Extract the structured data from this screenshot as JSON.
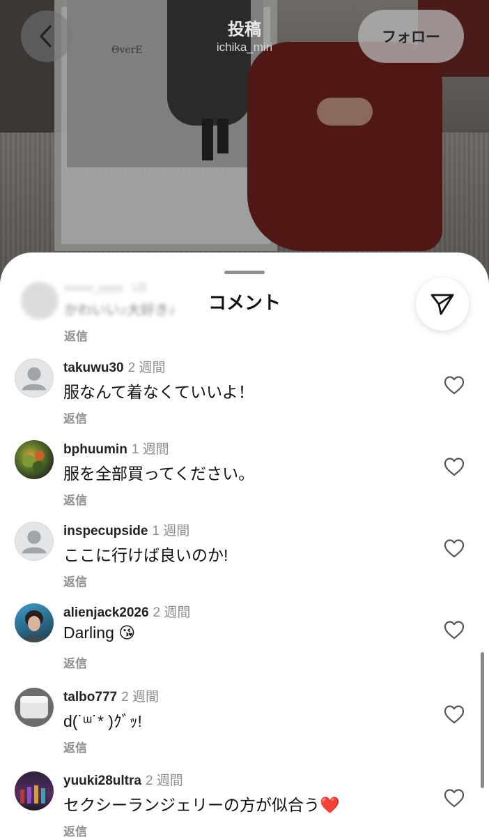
{
  "header": {
    "title": "投稿",
    "subtitle": "ichika_miri",
    "follow_label": "フォロー",
    "panel_text": "ΘverE"
  },
  "sheet": {
    "title": "コメント",
    "blurred_comment": {
      "user": "xxxxxx_yyyyy · 1日",
      "text": "かわいい♪大好き♪",
      "reply": "返信"
    }
  },
  "comments": [
    {
      "user": "takuwu30",
      "time": "2 週間",
      "text": "服なんて着なくていいよ！",
      "reply": "返信",
      "avatar": "default"
    },
    {
      "user": "bphuumin",
      "time": "1 週間",
      "text": "服を全部買ってください。",
      "reply": "返信",
      "avatar": "plants"
    },
    {
      "user": "inspecupside",
      "time": "1 週間",
      "text": "ここに行けば良いのか!",
      "reply": "返信",
      "avatar": "default"
    },
    {
      "user": "alienjack2026",
      "time": "2 週間",
      "text": "Darling 😘",
      "reply": "返信",
      "avatar": "person"
    },
    {
      "user": "talbo777",
      "time": "2 週間",
      "text": "d(˙ᵚ˙* )ｸﾞｯ!",
      "reply": "返信",
      "avatar": "cube"
    },
    {
      "user": "yuuki28ultra",
      "time": "2 週間",
      "text": "セクシーランジェリーの方が似合う❤️",
      "reply": "返信",
      "avatar": "group"
    }
  ],
  "icons": {
    "back": "chevron-left-icon",
    "share": "paper-plane-icon",
    "like": "heart-outline-icon"
  },
  "colors": {
    "secondary_text": "#8e8e8e",
    "follow_button": "#b9b9b9"
  }
}
